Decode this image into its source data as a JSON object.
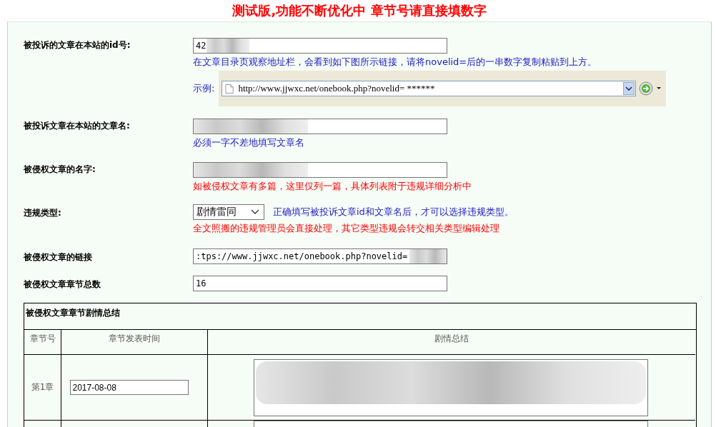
{
  "banner": "测试版,功能不断优化中 章节号请直接填数字",
  "fields": [
    {
      "kind": "text",
      "label": "被投诉的文章在本站的id号:",
      "value": "42",
      "redacted": true,
      "hints": [
        {
          "text": "在文章目录页观察地址栏，会看到如下图所示链接，请将novelid=后的一串数字复制粘贴到上方。",
          "color": "#1a1ac8"
        }
      ],
      "example": {
        "label": "示例:",
        "url": "http://www.jjwxc.net/onebook.php?novelid= ******"
      }
    },
    {
      "kind": "text",
      "label": "被投诉文章在本站的文章名:",
      "redacted": true,
      "hints": [
        {
          "text": "必须一字不差地填写文章名",
          "color": "#1a1ac8"
        }
      ]
    },
    {
      "kind": "text",
      "label": "被侵权文章的名字:",
      "redacted": true,
      "hints": [
        {
          "text": "如被侵权文章有多篇，这里仅列一篇，具体列表附于违规详细分析中",
          "color": "#ff0000"
        }
      ]
    },
    {
      "kind": "select",
      "label": "违规类型:",
      "value": "剧情雷同",
      "inline_hint": {
        "text": "正确填写被投诉文章id和文章名后，才可以选择违规类型。",
        "color": "#1a1ac8"
      },
      "hints": [
        {
          "text": "全文照搬的违规管理员会直接处理，其它类型违规会转交相关类型编辑处理",
          "color": "#ff0000"
        }
      ]
    },
    {
      "kind": "text",
      "label": "被侵权文章的链接",
      "value": ":tps://www.jjwxc.net/onebook.php?novelid=",
      "redacted": true
    },
    {
      "kind": "text",
      "label": "被侵权文章章节总数",
      "value": "16"
    }
  ],
  "summary_table": {
    "title": "被侵权文章章节剧情总结",
    "columns": [
      "章节号",
      "章节发表时间",
      "剧情总结"
    ],
    "rows": [
      {
        "chapter": "第1章",
        "date": "2017-08-08",
        "summary_redacted": true
      },
      {
        "partial": true
      }
    ]
  }
}
